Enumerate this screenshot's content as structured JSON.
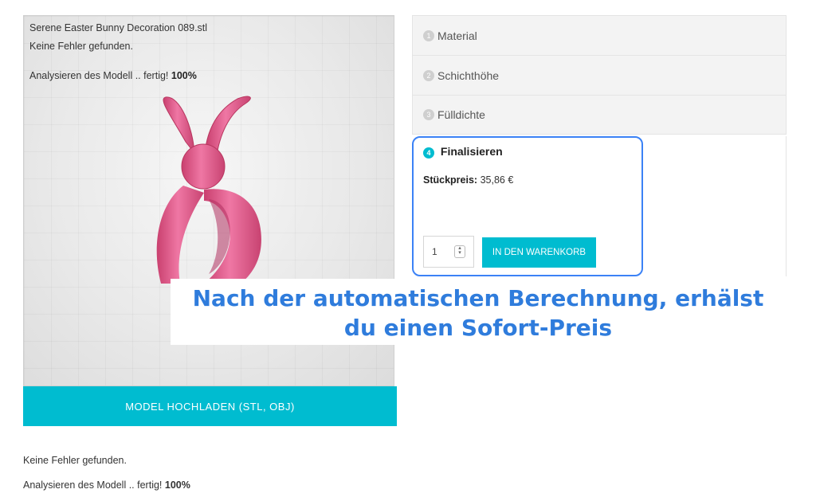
{
  "viewer": {
    "filename": "Serene Easter Bunny Decoration 089.stl",
    "status": "Keine Fehler gefunden.",
    "analysis_prefix": "Analysieren des Modell .. fertig!",
    "analysis_percent": "100%",
    "model": "bunny-ring-model",
    "model_color": "#e35d91"
  },
  "upload_button": {
    "label": "MODEL HOCHLADEN (STL, OBJ)"
  },
  "below": {
    "status": "Keine Fehler gefunden.",
    "analysis_prefix": "Analysieren des Modell .. fertig!",
    "analysis_percent": "100%"
  },
  "steps": [
    {
      "num": "1",
      "label": "Material"
    },
    {
      "num": "2",
      "label": "Schichthöhe"
    },
    {
      "num": "3",
      "label": "Fülldichte"
    },
    {
      "num": "4",
      "label": "Finalisieren"
    }
  ],
  "finalize": {
    "price_label": "Stückpreis:",
    "price_value": "35,86 €",
    "quantity": "1",
    "cart_button": "IN DEN WARENKORB"
  },
  "callout": {
    "line1": "Nach der automatischen Berechnung, erhälst",
    "line2": "du einen Sofort-Preis"
  },
  "colors": {
    "accent": "#00bcd0",
    "highlight_border": "#3b82f6",
    "callout_text": "#2f7cdc"
  }
}
